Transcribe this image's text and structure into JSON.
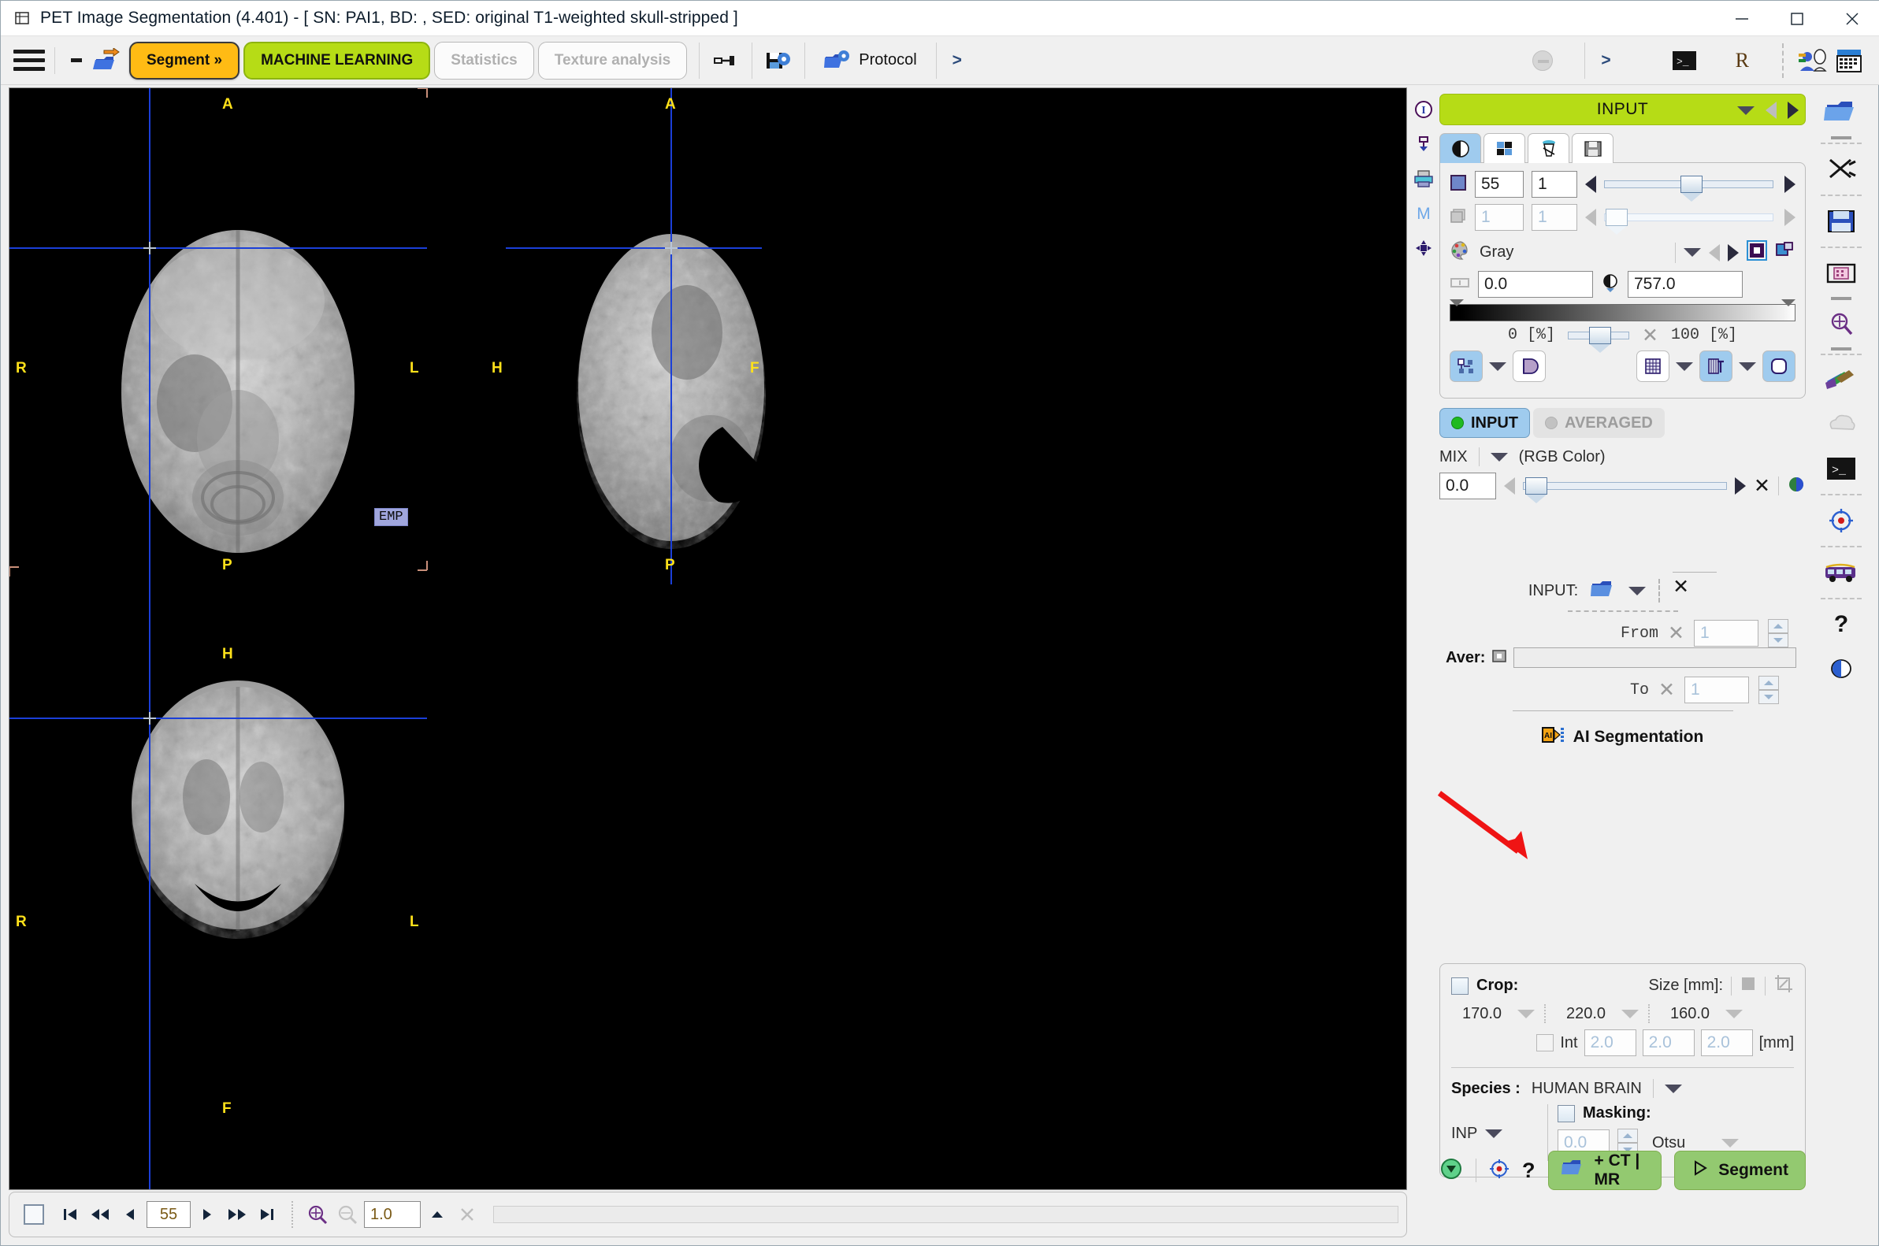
{
  "window": {
    "title": "PET Image Segmentation (4.401) - [ SN: PAI1, BD: , SED: original T1-weighted skull-stripped ]",
    "app_icon": "application-icon",
    "minimize": "—",
    "maximize": "□",
    "close": "✕"
  },
  "toolbar": {
    "menu_icon": "hamburger-menu-icon",
    "minus_icon": "minus-icon",
    "open_icon": "open-folder-arrow-icon",
    "buttons": [
      {
        "label": "Segment »",
        "style": "orange",
        "enabled": true
      },
      {
        "label": "MACHINE LEARNING",
        "style": "green",
        "enabled": true
      },
      {
        "label": "Statistics",
        "style": "plain",
        "enabled": false
      },
      {
        "label": "Texture analysis",
        "style": "plain",
        "enabled": false
      }
    ],
    "link_icon": "connector-icon",
    "save_settings_icon": "save-gear-icon",
    "protocol_icon": "open-gear-icon",
    "protocol_label": "Protocol",
    "expand_chevron": ">",
    "right_chevron": ">",
    "disabled_circle_icon": "disabled-circle-icon",
    "terminal_icon": "terminal-icon",
    "r_label": "R",
    "users_icon": "users-icon",
    "calendar_icon": "calendar-icon"
  },
  "viewer": {
    "panes": [
      {
        "name": "transverse",
        "top_label": "A",
        "bottom_label": "P",
        "left_label": "R",
        "right_label": "L"
      },
      {
        "name": "sagittal",
        "top_label": "A",
        "bottom_label": "P",
        "left_label": "H",
        "right_label": "F"
      },
      {
        "name": "coronal",
        "top_label": "H",
        "bottom_label": "F",
        "left_label": "R",
        "right_label": "L"
      }
    ],
    "emp_tag": "EMP"
  },
  "viewer_bar": {
    "checkbox_icon": "square-checkbox-icon",
    "first_icon": "first-slice-icon",
    "fastback_icon": "fast-back-icon",
    "prev_icon": "prev-slice-icon",
    "slice_value": "55",
    "next_icon": "next-slice-icon",
    "fastfwd_icon": "fast-forward-icon",
    "last_icon": "last-slice-icon",
    "zoom_in_icon": "zoom-in-icon",
    "zoom_out_icon": "zoom-out-icon",
    "zoom_value": "1.0",
    "up_icon": "triangle-up-icon",
    "clear_icon": "clear-x-icon"
  },
  "left_strip": {
    "items": [
      {
        "icon": "info-i-icon"
      },
      {
        "icon": "transfer-icon"
      },
      {
        "icon": "printer-icon"
      },
      {
        "icon": "m-letter-icon"
      },
      {
        "icon": "move-cross-icon"
      }
    ]
  },
  "right_strip": {
    "items": [
      {
        "icon": "open-folder-icon"
      },
      {
        "icon": "cut-scissors-icon"
      },
      {
        "icon": "save-floppy-icon"
      },
      {
        "icon": "page-layout-icon"
      },
      {
        "icon": "zoom-in-icon"
      },
      {
        "icon": "color-fan-icon"
      },
      {
        "icon": "cloud-shape-icon"
      },
      {
        "icon": "terminal-icon"
      },
      {
        "icon": "target-icon"
      },
      {
        "icon": "bus-icon"
      },
      {
        "icon": "help-question-icon"
      },
      {
        "icon": "contrast-icon"
      }
    ]
  },
  "panel": {
    "header_title": "INPUT",
    "header_dropdown_icon": "chevron-down-icon",
    "header_prev_icon": "prev-arrow-icon",
    "header_next_icon": "next-arrow-icon",
    "tabs": [
      {
        "icon": "contrast-icon",
        "selected": true
      },
      {
        "icon": "layout-grid-icon",
        "selected": false
      },
      {
        "icon": "fusion-icon",
        "selected": false
      },
      {
        "icon": "save-floppy-icon",
        "selected": false
      }
    ],
    "slice_row": {
      "icon": "slice-square-icon",
      "value1": "55",
      "value2": "1",
      "prev_icon": "prev-arrow-icon",
      "next_icon": "next-arrow-icon",
      "slider_pct": 50
    },
    "frame_row": {
      "icon": "frames-stack-icon",
      "value1": "1",
      "value2": "1",
      "prev_icon": "prev-arrow-icon",
      "next_icon": "next-arrow-icon",
      "slider_pct": 0,
      "enabled": false
    },
    "colortable": {
      "palette_icon": "palette-icon",
      "name": "Gray",
      "dropdown_icon": "chevron-down-icon",
      "prev_icon": "prev-arrow-icon",
      "next_icon": "next-arrow-icon",
      "invert_icon": "invert-colors-icon",
      "copy_icon": "copy-colors-icon"
    },
    "window_level": {
      "range_icon": "range-icon",
      "min": "0.0",
      "contrast_icon": "contrast-icon",
      "max": "757.0",
      "pct_min": "0  [%]",
      "pct_max": "100  [%]",
      "pct_slider": 40,
      "reset_icon": "reset-x-icon"
    },
    "display_buttons": [
      {
        "icon": "layout-nodes-icon",
        "selected": true,
        "has_dropdown": true
      },
      {
        "icon": "overlay-icon",
        "selected": false,
        "has_dropdown": false
      },
      {
        "icon": "grid-icon",
        "selected": false,
        "has_dropdown": true
      },
      {
        "icon": "annotate-icon",
        "selected": true,
        "has_dropdown": true
      },
      {
        "icon": "smooth-icon",
        "selected": true,
        "has_dropdown": false
      }
    ],
    "source_tabs": [
      {
        "label": "INPUT",
        "selected": true
      },
      {
        "label": "AVERAGED",
        "selected": false
      }
    ],
    "mix": {
      "label": "MIX",
      "dropdown_icon": "chevron-down-icon",
      "mode": "(RGB Color)",
      "value": "0.0",
      "prev_icon": "prev-arrow-icon",
      "next_icon": "next-arrow-icon",
      "slider_pct": 3,
      "reset_icon": "reset-x-icon",
      "blend_icon": "blend-sphere-icon"
    },
    "input_section": {
      "label": "INPUT:",
      "open_icon": "open-folder-icon",
      "dropdown_icon": "chevron-down-icon",
      "clear_icon": "clear-x-icon",
      "from_label": "From",
      "from_clear_icon": "clear-x-icon",
      "from_value": "1",
      "aver_label": "Aver:",
      "aver_icon": "average-icon",
      "to_label": "To",
      "to_clear_icon": "clear-x-icon",
      "to_value": "1"
    },
    "ai_segmentation": {
      "icon": "ai-segmentation-icon",
      "label": "AI Segmentation",
      "annotation_arrow": "red-pointer-arrow",
      "annotation_color": "#ef1414"
    },
    "crop": {
      "checkbox_label": "Crop:",
      "checked": false,
      "size_label": "Size [mm]:",
      "square_icon": "filled-square-icon",
      "crop_tool_icon": "crop-tool-icon",
      "dims": [
        "170.0",
        "220.0",
        "160.0"
      ],
      "dim_dropdown_icon": "chevron-down-icon",
      "int_label": "Int",
      "int_checked": false,
      "int_values": [
        "2.0",
        "2.0",
        "2.0"
      ],
      "unit": "[mm]"
    },
    "species": {
      "label": "Species :",
      "value": "HUMAN BRAIN",
      "dropdown_icon": "chevron-down-icon"
    },
    "masking": {
      "source": "INP",
      "source_dropdown_icon": "chevron-down-icon",
      "label": "Masking:",
      "checked": false,
      "threshold": "0.0",
      "method": "Otsu",
      "method_dropdown_icon": "chevron-down-icon"
    },
    "footer": {
      "save_icon": "green-save-icon",
      "target_icon": "target-icon",
      "help_label": "?",
      "ct_mr_icon": "open-folder-icon",
      "ct_mr_label": "+ CT | MR",
      "segment_icon": "play-arrow-icon",
      "segment_label": "Segment"
    }
  }
}
